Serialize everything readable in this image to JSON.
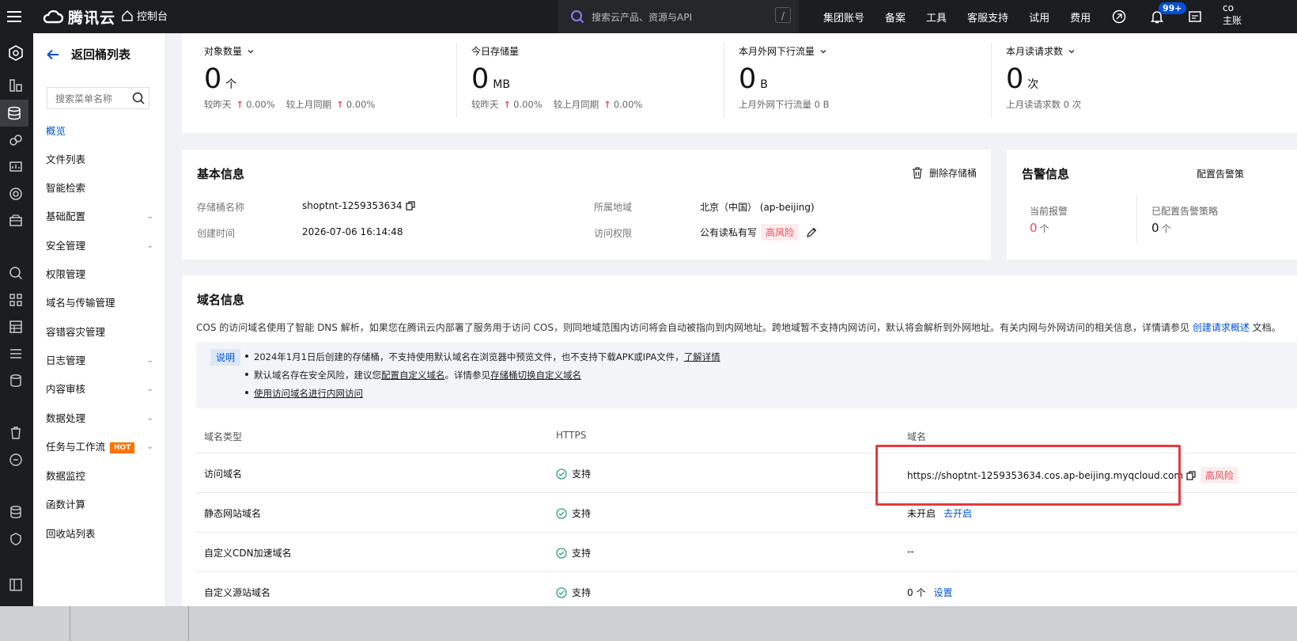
{
  "topbar": {
    "brand": "腾讯云",
    "console": "控制台",
    "search_placeholder": "搜索云产品、资源与API",
    "search_shortcut": "/",
    "nav": [
      "集团账号",
      "备案",
      "工具",
      "客服支持",
      "试用",
      "费用"
    ],
    "notification_badge": "99+",
    "account_line1": "co",
    "account_line2": "主账"
  },
  "sidebar": {
    "back_label": "返回桶列表",
    "search_placeholder": "搜索菜单名称",
    "items": [
      {
        "label": "概览",
        "active": true,
        "expandable": false
      },
      {
        "label": "文件列表",
        "expandable": false
      },
      {
        "label": "智能检索",
        "expandable": false
      },
      {
        "label": "基础配置",
        "expandable": true
      },
      {
        "label": "安全管理",
        "expandable": true
      },
      {
        "label": "权限管理",
        "expandable": false
      },
      {
        "label": "域名与传输管理",
        "expandable": false
      },
      {
        "label": "容错容灾管理",
        "expandable": false
      },
      {
        "label": "日志管理",
        "expandable": true
      },
      {
        "label": "内容审核",
        "expandable": true
      },
      {
        "label": "数据处理",
        "expandable": true
      },
      {
        "label": "任务与工作流",
        "expandable": true,
        "tag": "HOT"
      },
      {
        "label": "数据监控",
        "expandable": false
      },
      {
        "label": "函数计算",
        "expandable": false
      },
      {
        "label": "回收站列表",
        "expandable": false
      }
    ]
  },
  "stats": [
    {
      "label": "对象数量",
      "dropdown": true,
      "value": "0",
      "unit": "个",
      "cmp1_label": "较昨天",
      "cmp1_value": "0.00%",
      "cmp2_label": "较上月同期",
      "cmp2_value": "0.00%"
    },
    {
      "label": "今日存储量",
      "dropdown": false,
      "value": "0",
      "unit": "MB",
      "cmp1_label": "较昨天",
      "cmp1_value": "0.00%",
      "cmp2_label": "较上月同期",
      "cmp2_value": "0.00%"
    },
    {
      "label": "本月外网下行流量",
      "dropdown": true,
      "value": "0",
      "unit": "B",
      "note": "上月外网下行流量 0 B"
    },
    {
      "label": "本月读请求数",
      "dropdown": true,
      "value": "0",
      "unit": "次",
      "note": "上月读请求数 0 次"
    }
  ],
  "basic_info": {
    "title": "基本信息",
    "delete_label": "删除存储桶",
    "bucket_name_label": "存储桶名称",
    "bucket_name": "shoptnt-1259353634",
    "created_label": "创建时间",
    "created": "2026-07-06 16:14:48",
    "region_label": "所属地域",
    "region": "北京（中国） (ap-beijing)",
    "access_label": "访问权限",
    "access": "公有读私有写",
    "access_risk": "高风险"
  },
  "alarm": {
    "title": "告警信息",
    "config_label": "配置告警策",
    "current_label": "当前报警",
    "current_value": "0",
    "current_unit": "个",
    "configured_label": "已配置告警策略",
    "configured_value": "0",
    "configured_unit": "个"
  },
  "domain": {
    "title": "域名信息",
    "desc": "COS 的访问域名使用了智能 DNS 解析，如果您在腾讯云内部署了服务用于访问 COS，则同地域范围内访问将会自动被指向到内网地址。跨地域暂不支持内网访问，默认将会解析到外网地址。有关内网与外网访问的相关信息，详情请参见",
    "desc_link": "创建请求概述",
    "desc_tail": "文档。",
    "note_tag": "说明",
    "note1": "2024年1月1日后创建的存储桶，不支持使用默认域名在浏览器中预览文件，也不支持下载APK或IPA文件，",
    "note1_link": "了解详情",
    "note2": "默认域名存在安全风险，建议您",
    "note2_link1": "配置自定义域名",
    "note2_mid": "。详情参见",
    "note2_link2": "存储桶切换自定义域名",
    "note3_link": "使用访问域名进行内网访问",
    "columns": [
      "域名类型",
      "HTTPS",
      "域名"
    ],
    "rows": [
      {
        "type": "访问域名",
        "https": "支持",
        "domain": "https://shoptnt-1259353634.cos.ap-beijing.myqcloud.com",
        "risk": "高风险"
      },
      {
        "type": "静态网站域名",
        "https": "支持",
        "domain": "未开启",
        "action": "去开启"
      },
      {
        "type": "自定义CDN加速域名",
        "https": "支持",
        "domain": "--"
      },
      {
        "type": "自定义源站域名",
        "https": "支持",
        "domain": "0 个",
        "action": "设置"
      }
    ]
  }
}
